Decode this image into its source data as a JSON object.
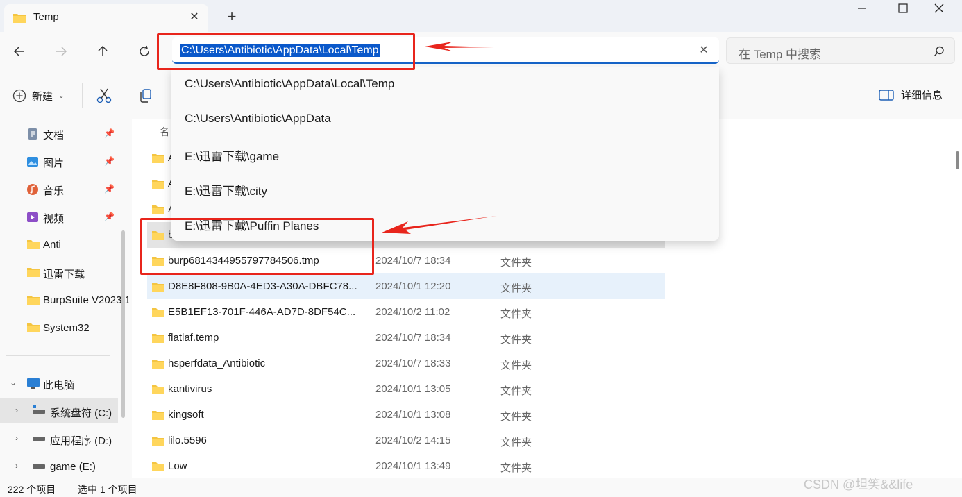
{
  "window": {
    "tab_title": "Temp",
    "new_tab": "+",
    "tab_close": "✕"
  },
  "address": {
    "path": "C:\\Users\\Antibiotic\\AppData\\Local\\Temp",
    "clear": "✕"
  },
  "search": {
    "placeholder": "在 Temp 中搜索"
  },
  "toolbar": {
    "new_label": "新建",
    "details_label": "详细信息"
  },
  "suggestions": [
    "C:\\Users\\Antibiotic\\AppData\\Local\\Temp",
    "C:\\Users\\Antibiotic\\AppData",
    "E:\\迅雷下载\\game",
    "E:\\迅雷下载\\city",
    "E:\\迅雷下载\\Puffin Planes"
  ],
  "sidebar": {
    "quick": [
      {
        "label": "文档",
        "icon": "documents-icon",
        "pinned": true
      },
      {
        "label": "图片",
        "icon": "pictures-icon",
        "pinned": true
      },
      {
        "label": "音乐",
        "icon": "music-icon",
        "pinned": true
      },
      {
        "label": "视频",
        "icon": "videos-icon",
        "pinned": true
      },
      {
        "label": "Anti",
        "icon": "folder-icon",
        "pinned": false
      },
      {
        "label": "迅雷下载",
        "icon": "folder-icon",
        "pinned": false
      },
      {
        "label": "BurpSuite V2023.1",
        "icon": "folder-icon",
        "pinned": false
      },
      {
        "label": "System32",
        "icon": "folder-icon",
        "pinned": false
      }
    ],
    "this_pc": "此电脑",
    "drives": [
      {
        "label": "系统盘符 (C:)",
        "selected": true
      },
      {
        "label": "应用程序 (D:)",
        "selected": false
      },
      {
        "label": "game (E:)",
        "selected": false
      }
    ]
  },
  "filelist": {
    "column_name": "名",
    "rows": [
      {
        "name": "A",
        "date": "",
        "type": ""
      },
      {
        "name": "A",
        "date": "",
        "type": ""
      },
      {
        "name": "A",
        "date": "",
        "type": ""
      },
      {
        "name": "b",
        "date": "",
        "type": ""
      },
      {
        "name": "burp6814344955797784506.tmp",
        "date": "2024/10/7 18:34",
        "type": "文件夹"
      },
      {
        "name": "D8E8F808-9B0A-4ED3-A30A-DBFC78...",
        "date": "2024/10/1 12:20",
        "type": "文件夹"
      },
      {
        "name": "E5B1EF13-701F-446A-AD7D-8DF54C...",
        "date": "2024/10/2 11:02",
        "type": "文件夹"
      },
      {
        "name": "flatlaf.temp",
        "date": "2024/10/7 18:34",
        "type": "文件夹"
      },
      {
        "name": "hsperfdata_Antibiotic",
        "date": "2024/10/7 18:33",
        "type": "文件夹"
      },
      {
        "name": "kantivirus",
        "date": "2024/10/1 13:05",
        "type": "文件夹"
      },
      {
        "name": "kingsoft",
        "date": "2024/10/1 13:08",
        "type": "文件夹"
      },
      {
        "name": "lilo.5596",
        "date": "2024/10/2 14:15",
        "type": "文件夹"
      },
      {
        "name": "Low",
        "date": "2024/10/1 13:49",
        "type": "文件夹"
      }
    ]
  },
  "status": {
    "count": "222 个项目",
    "selected": "选中 1 个项目"
  },
  "watermark": "CSDN @坦笑&&life",
  "colors": {
    "accent": "#0a58ca",
    "annotation": "#e8251c",
    "folder": "#f4c542"
  }
}
